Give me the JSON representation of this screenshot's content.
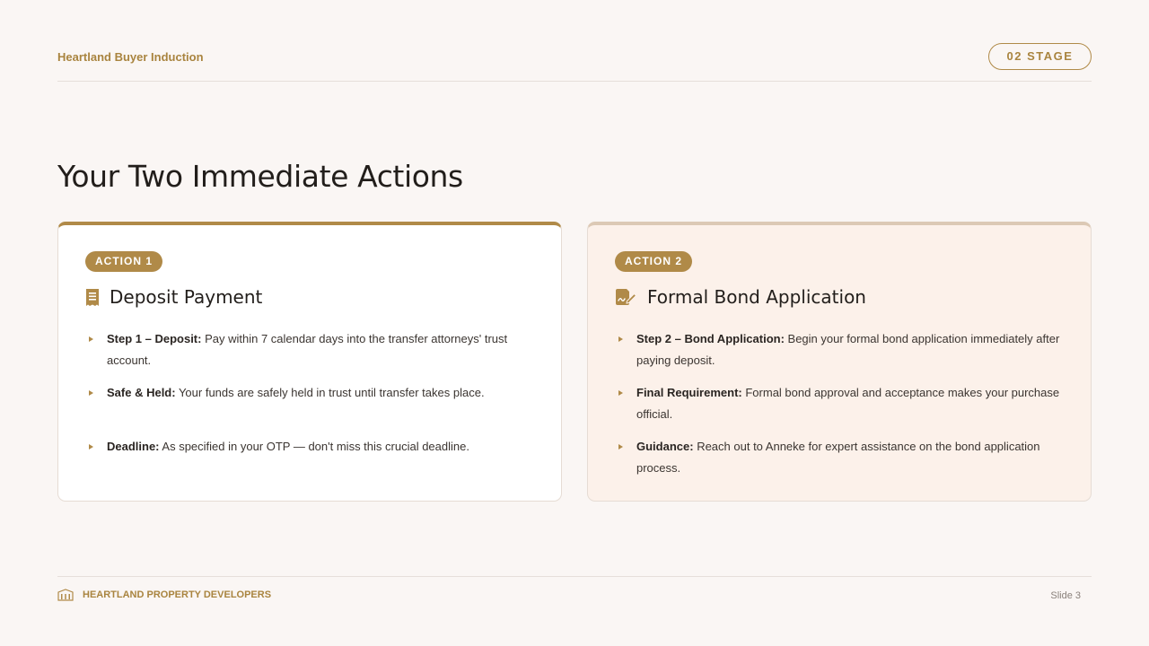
{
  "header": {
    "brand": "Heartland Buyer Induction",
    "stage": "02 STAGE"
  },
  "title": "Your Two Immediate Actions",
  "cards": [
    {
      "badge": "ACTION 1",
      "icon": "receipt-icon",
      "heading": "Deposit Payment",
      "bullets": [
        {
          "lead": "Step 1 – Deposit:",
          "text": " Pay within 7 calendar days into the transfer attorneys' trust account."
        },
        {
          "lead": "Safe & Held:",
          "text": " Your funds are safely held in trust until transfer takes place."
        },
        {
          "lead": "Deadline:",
          "text": " As specified in your OTP — don't miss this crucial deadline."
        }
      ]
    },
    {
      "badge": "ACTION 2",
      "icon": "signed-document-icon",
      "heading": "Formal Bond Application",
      "bullets": [
        {
          "lead": "Step 2 – Bond Application:",
          "text": " Begin your formal bond application immediately after paying deposit."
        },
        {
          "lead": "Final Requirement:",
          "text": " Formal bond approval and acceptance makes your purchase official."
        },
        {
          "lead": "Guidance:",
          "text": " Reach out to Anneke for expert assistance on the bond application process."
        }
      ]
    }
  ],
  "footer": {
    "icon": "building-icon",
    "company": "HEARTLAND PROPERTY DEVELOPERS",
    "slide": "Slide 3"
  },
  "colors": {
    "accent": "#b08a48",
    "background": "#faf6f4",
    "card2_background": "#fcf1ea"
  }
}
